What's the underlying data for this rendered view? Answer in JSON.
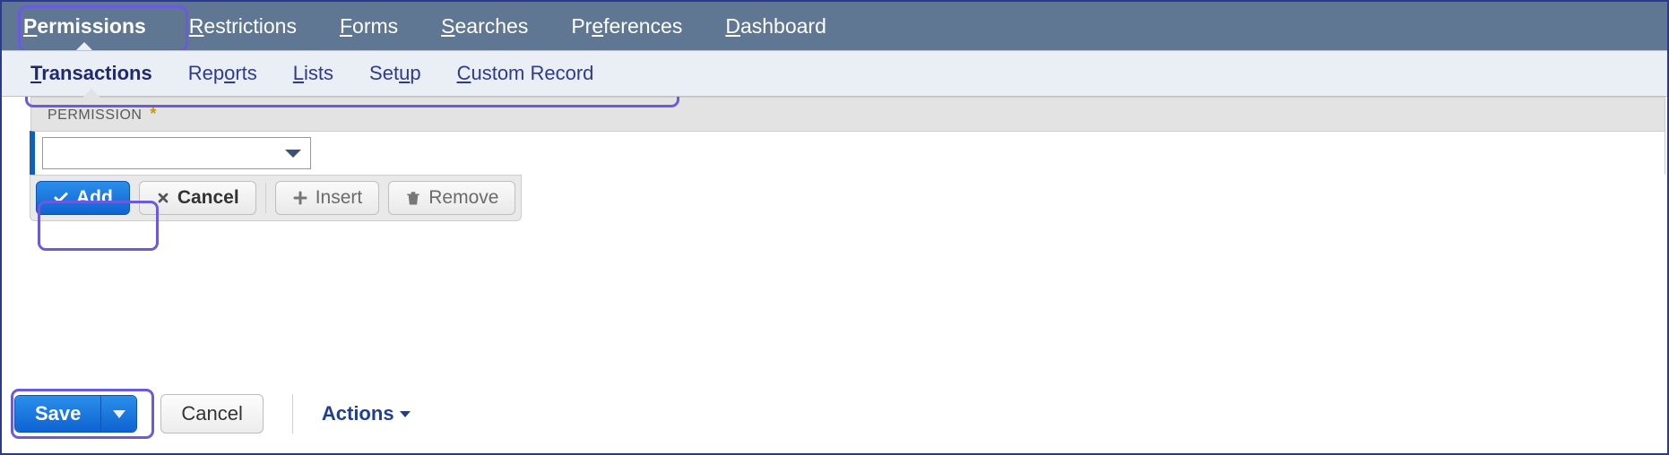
{
  "top_tabs": {
    "permissions": {
      "pre": "P",
      "rest": "ermissions"
    },
    "restrictions": {
      "pre": "R",
      "rest": "estrictions"
    },
    "forms": {
      "pre": "F",
      "rest": "orms"
    },
    "searches": {
      "pre": "S",
      "rest": "earches"
    },
    "preferences": {
      "before": "Pr",
      "u": "e",
      "after": "ferences"
    },
    "dashboard": {
      "pre": "D",
      "rest": "ashboard"
    }
  },
  "sub_tabs": {
    "transactions": {
      "pre": "T",
      "rest": "ransactions"
    },
    "reports": {
      "before": "Rep",
      "u": "o",
      "after": "rts"
    },
    "lists": {
      "pre": "L",
      "rest": "ists"
    },
    "setup": {
      "before": "Set",
      "u": "u",
      "after": "p"
    },
    "custom_record": {
      "pre": "C",
      "rest": "ustom Record"
    }
  },
  "column_header": "PERMISSION",
  "required_marker": "*",
  "permission_value": "",
  "row_buttons": {
    "add": "Add",
    "cancel": "Cancel",
    "insert": "Insert",
    "remove": "Remove"
  },
  "footer": {
    "save": "Save",
    "cancel": "Cancel",
    "actions": "Actions"
  }
}
